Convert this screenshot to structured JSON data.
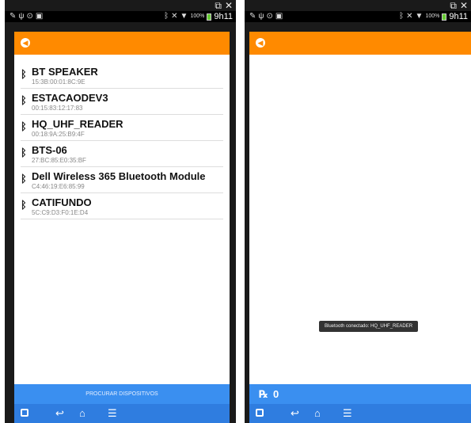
{
  "left_screen": {
    "status": {
      "battery_pct": "100%",
      "time": "9h11"
    },
    "devices": [
      {
        "name": "BT SPEAKER",
        "address": "15:3B:00:01:8C:9E"
      },
      {
        "name": "ESTACAODEV3",
        "address": "00:15:83:12:17:83"
      },
      {
        "name": "HQ_UHF_READER",
        "address": "00:18:9A:25:B9:4F"
      },
      {
        "name": "BTS-06",
        "address": "27:BC:85:E0:35:BF"
      },
      {
        "name": "Dell Wireless 365 Bluetooth Module",
        "address": "C4:46:19:E6:85:99"
      },
      {
        "name": "CATIFUNDO",
        "address": "5C:C9:D3:F0:1E:D4"
      }
    ],
    "scan_button_label": "PROCURAR DISPOSITIVOS"
  },
  "right_screen": {
    "status": {
      "battery_pct": "100%",
      "time": "9h11"
    },
    "received_count": "0",
    "toast": "Bluetooth conectado: HQ_UHF_READER"
  },
  "colors": {
    "appbar": "#ff8a00",
    "actionbar": "#3a8ff0",
    "navbar": "#2f7de0"
  },
  "icons": [
    "bluetooth-icon",
    "back-arrow-icon",
    "receive-icon",
    "home-icon",
    "recent-apps-icon",
    "window-close-icon"
  ]
}
